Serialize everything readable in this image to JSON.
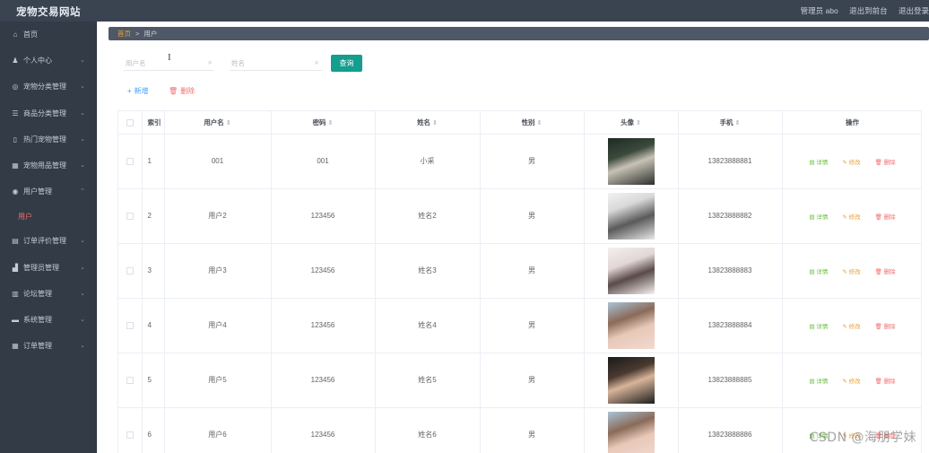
{
  "header": {
    "site_title": "宠物交易网站",
    "admin_label": "管理员 abo",
    "backend_link": "退出到前台",
    "logout_link": "退出登录"
  },
  "sidebar": {
    "items": [
      {
        "label": "首页",
        "icon": "home-icon",
        "glyph": "⌂"
      },
      {
        "label": "个人中心",
        "icon": "user-icon",
        "glyph": "♟"
      },
      {
        "label": "宠物分类管理",
        "icon": "category-icon",
        "glyph": "◎"
      },
      {
        "label": "商品分类管理",
        "icon": "list-icon",
        "glyph": "☰"
      },
      {
        "label": "热门宠物管理",
        "icon": "pet-icon",
        "glyph": "▯"
      },
      {
        "label": "宠物用品管理",
        "icon": "goods-icon",
        "glyph": "▦"
      },
      {
        "label": "用户管理",
        "icon": "users-icon",
        "glyph": "◉"
      },
      {
        "label": "订单评价管理",
        "icon": "review-icon",
        "glyph": "▤"
      },
      {
        "label": "管理员管理",
        "icon": "admin-icon",
        "glyph": "▟"
      },
      {
        "label": "论坛管理",
        "icon": "forum-icon",
        "glyph": "▥"
      },
      {
        "label": "系统管理",
        "icon": "system-icon",
        "glyph": "▬"
      },
      {
        "label": "订单管理",
        "icon": "order-icon",
        "glyph": "▦"
      }
    ],
    "active_sub": "用户"
  },
  "breadcrumb": {
    "home": "首页",
    "separator": ">",
    "current": "用户"
  },
  "search": {
    "username_placeholder": "用户名",
    "name_placeholder": "姓名",
    "query_label": "查询",
    "cursor_glyph": "I"
  },
  "actions": {
    "add_label": "新增",
    "delete_label": "删除"
  },
  "table": {
    "columns": {
      "index": "索引",
      "username": "用户名",
      "password": "密码",
      "name": "姓名",
      "gender": "性别",
      "avatar": "头像",
      "phone": "手机",
      "ops": "操作"
    },
    "rows": [
      {
        "index": "1",
        "username": "001",
        "password": "001",
        "name": "小采",
        "gender": "男",
        "phone": "13823888881"
      },
      {
        "index": "2",
        "username": "用户2",
        "password": "123456",
        "name": "姓名2",
        "gender": "男",
        "phone": "13823888882"
      },
      {
        "index": "3",
        "username": "用户3",
        "password": "123456",
        "name": "姓名3",
        "gender": "男",
        "phone": "13823888883"
      },
      {
        "index": "4",
        "username": "用户4",
        "password": "123456",
        "name": "姓名4",
        "gender": "男",
        "phone": "13823888884"
      },
      {
        "index": "5",
        "username": "用户5",
        "password": "123456",
        "name": "姓名5",
        "gender": "男",
        "phone": "13823888885"
      },
      {
        "index": "6",
        "username": "用户6",
        "password": "123456",
        "name": "姓名6",
        "gender": "男",
        "phone": "13823888886"
      }
    ],
    "op_detail": "详情",
    "op_edit": "修改",
    "op_delete": "删除"
  },
  "watermark": "CSDN @海朋学妹",
  "colors": {
    "topbar": "#3a4350",
    "sidebar": "#323b46",
    "primary_button": "#139e8f",
    "active_sub": "#f56c6c",
    "detail": "#67c23a",
    "edit": "#e6a23c",
    "delete": "#f56c6c"
  }
}
